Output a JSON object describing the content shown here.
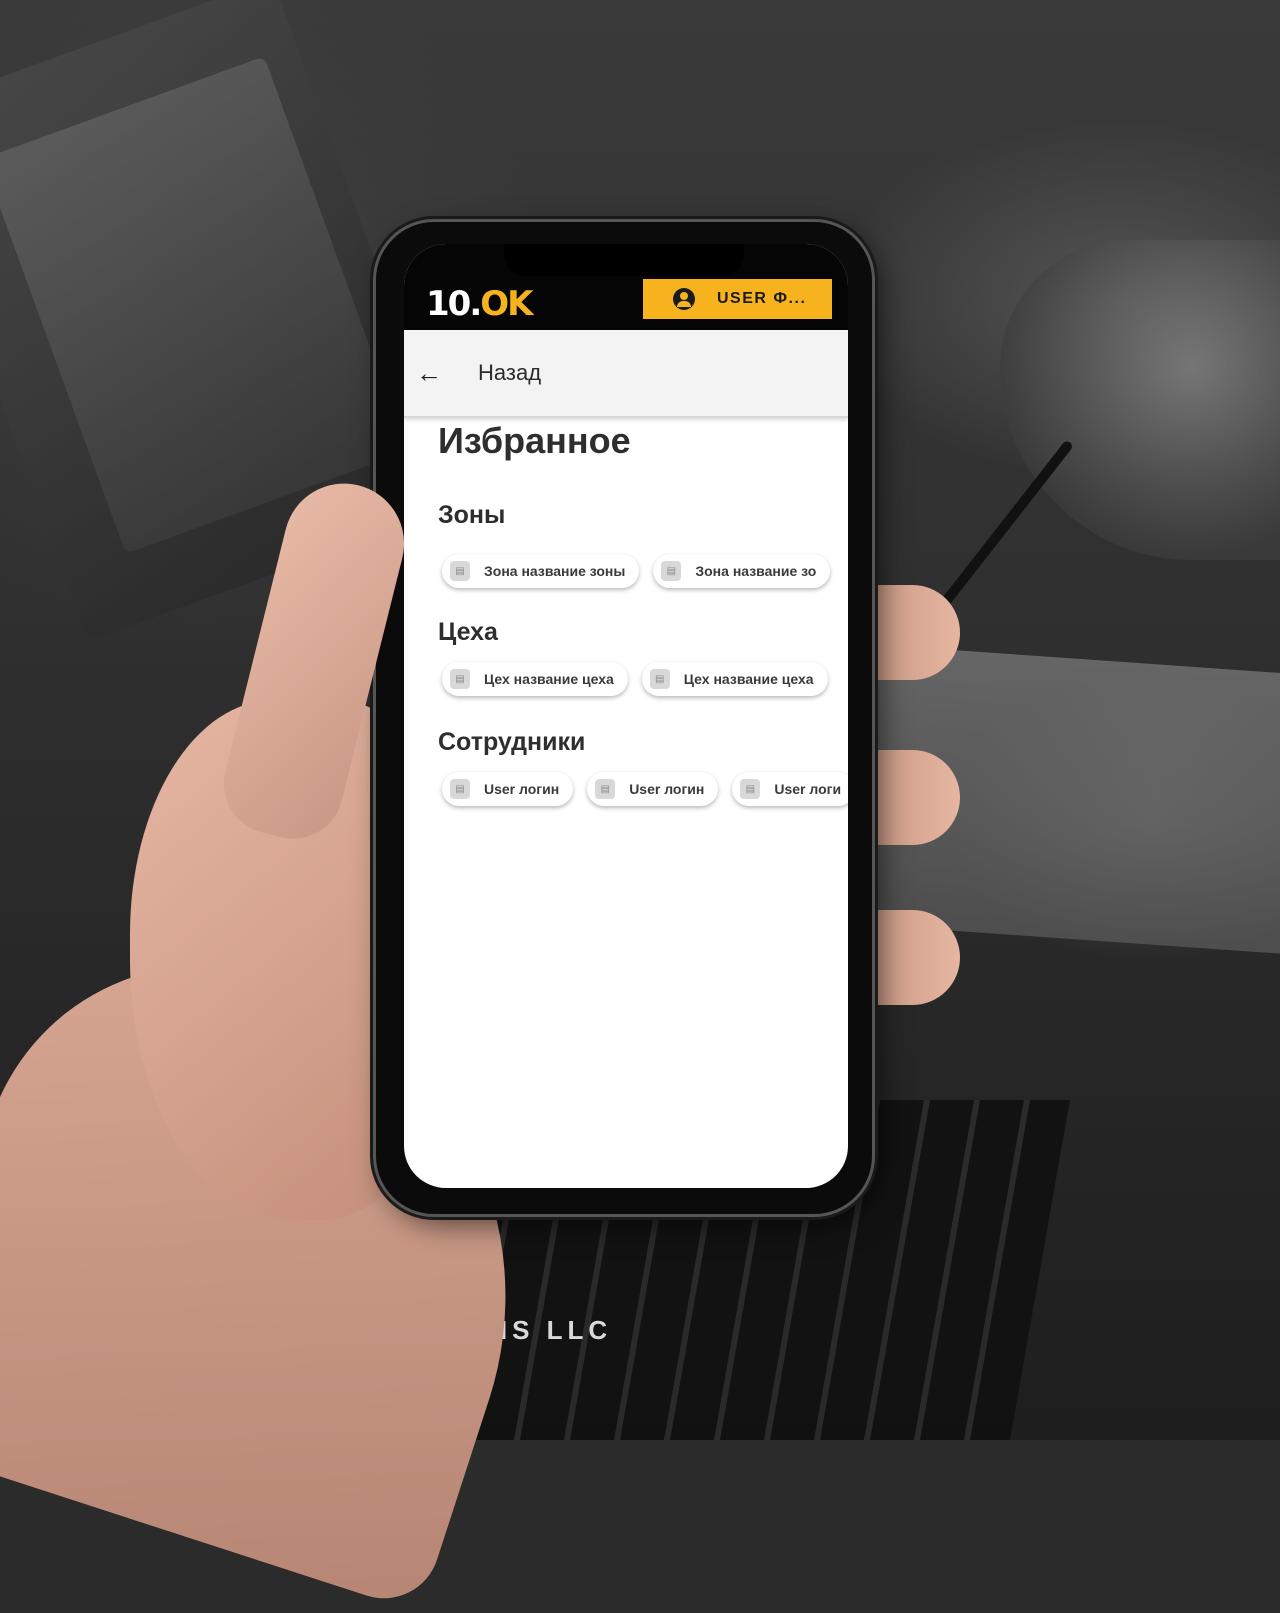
{
  "app": {
    "logo": {
      "main": "10.",
      "accent": "OK"
    },
    "user_button": {
      "label": "USER Ф...",
      "icon": "account-circle-icon"
    },
    "accent_color": "#f7b31d"
  },
  "nav": {
    "back_icon": "arrow-left-icon",
    "back_label": "Назад"
  },
  "page": {
    "title": "Избранное",
    "sections": [
      {
        "title": "Зоны",
        "chips": [
          {
            "label": "Зона название зоны",
            "icon": "building-icon"
          },
          {
            "label": "Зона название зо",
            "icon": "building-icon"
          }
        ]
      },
      {
        "title": "Цеха",
        "chips": [
          {
            "label": "Цех название цеха",
            "icon": "building-icon"
          },
          {
            "label": "Цех название цеха",
            "icon": "building-icon"
          }
        ]
      },
      {
        "title": "Сотрудники",
        "chips": [
          {
            "label": "User логин",
            "icon": "user-icon"
          },
          {
            "label": "User логин",
            "icon": "user-icon"
          },
          {
            "label": "User логи",
            "icon": "user-icon"
          }
        ]
      }
    ]
  },
  "background": {
    "caption": "TIONS LLC"
  }
}
